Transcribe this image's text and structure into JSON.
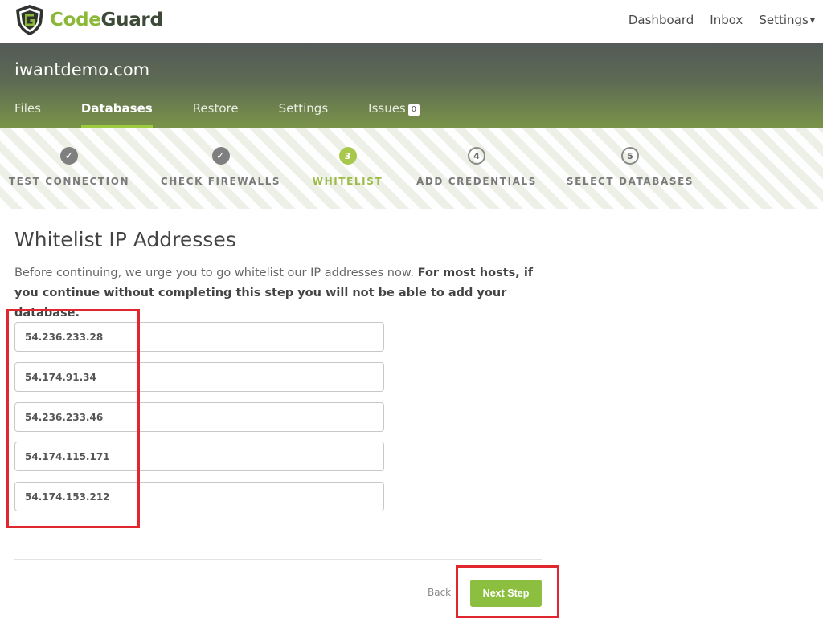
{
  "brand": {
    "name_part1": "Code",
    "name_part2": "Guard"
  },
  "topnav": {
    "dashboard": "Dashboard",
    "inbox": "Inbox",
    "settings": "Settings"
  },
  "site": {
    "name": "iwantdemo.com",
    "tabs": [
      {
        "label": "Files",
        "active": false
      },
      {
        "label": "Databases",
        "active": true
      },
      {
        "label": "Restore",
        "active": false
      },
      {
        "label": "Settings",
        "active": false
      },
      {
        "label": "Issues",
        "active": false,
        "badge": "0"
      }
    ]
  },
  "wizard": {
    "steps": [
      {
        "number": "✓",
        "label": "TEST CONNECTION",
        "state": "done"
      },
      {
        "number": "✓",
        "label": "CHECK FIREWALLS",
        "state": "done"
      },
      {
        "number": "3",
        "label": "WHITELIST",
        "state": "current"
      },
      {
        "number": "4",
        "label": "ADD CREDENTIALS",
        "state": "todo"
      },
      {
        "number": "5",
        "label": "SELECT DATABASES",
        "state": "todo"
      }
    ]
  },
  "main": {
    "title": "Whitelist IP Addresses",
    "intro_plain": "Before continuing, we urge you to go whitelist our IP addresses now. ",
    "intro_bold": "For most hosts, if you continue without completing this step you will not be able to add your database.",
    "ip_addresses": [
      "54.236.233.28",
      "54.174.91.34",
      "54.236.233.46",
      "54.174.115.171",
      "54.174.153.212"
    ]
  },
  "footer": {
    "back_label": "Back",
    "next_label": "Next Step"
  },
  "colors": {
    "accent_green": "#8cbf3f",
    "highlight_red": "#e0262f"
  }
}
